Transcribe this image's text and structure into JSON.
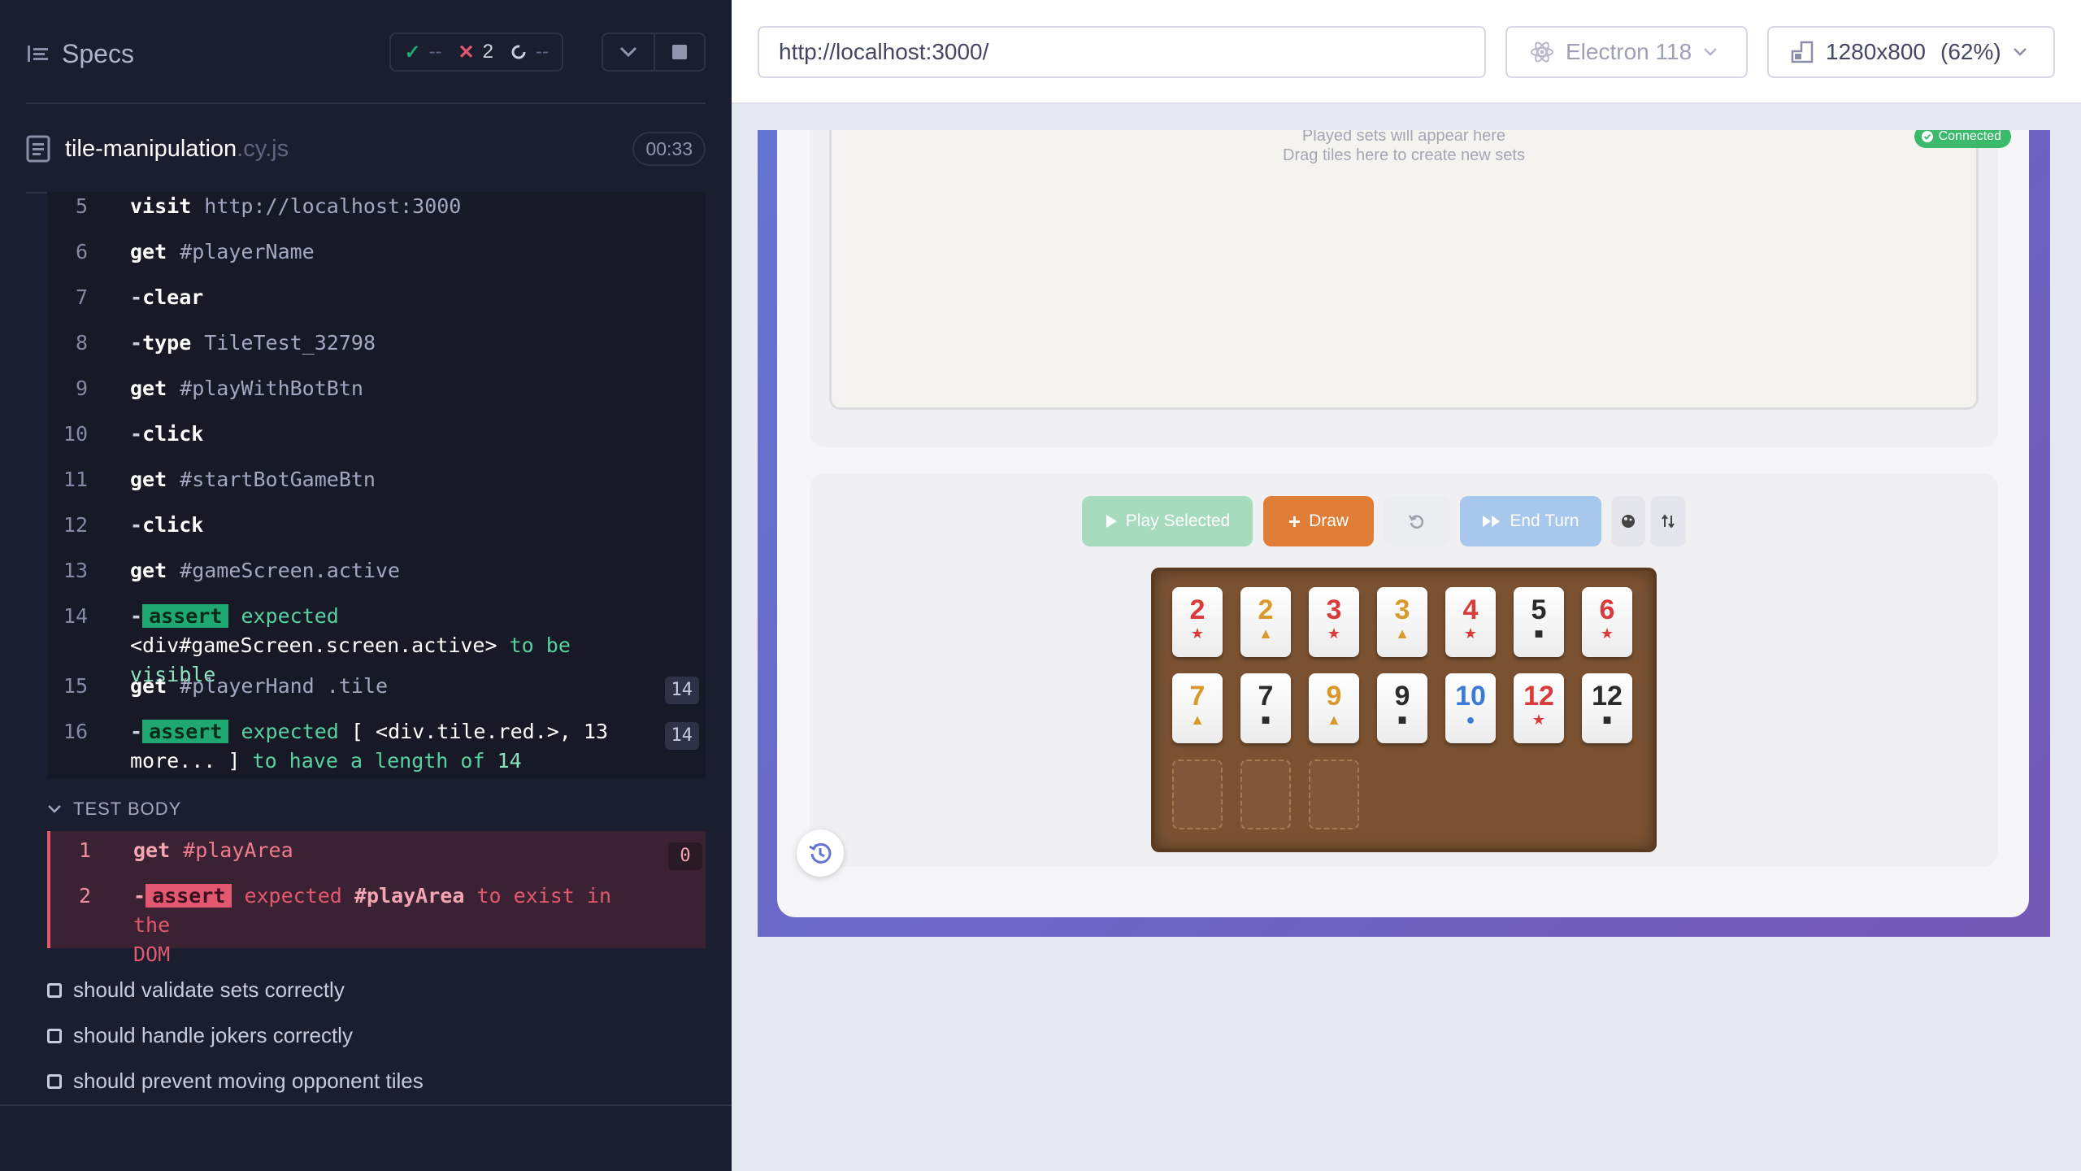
{
  "runner": {
    "header": {
      "title": "Specs",
      "stats": {
        "passed": "--",
        "failed": "2",
        "pending": "--"
      }
    },
    "spec": {
      "file": "tile-manipulation",
      "ext": ".cy.js",
      "duration": "00:33"
    },
    "hook_commands": [
      {
        "num": "5",
        "dash": "",
        "name": "visit",
        "arg": "http://localhost:3000"
      },
      {
        "num": "6",
        "dash": "",
        "name": "get",
        "arg": "#playerName"
      },
      {
        "num": "7",
        "dash": "-",
        "name": "clear",
        "arg": ""
      },
      {
        "num": "8",
        "dash": "-",
        "name": "type",
        "arg": "TileTest_32798"
      },
      {
        "num": "9",
        "dash": "",
        "name": "get",
        "arg": "#playWithBotBtn"
      },
      {
        "num": "10",
        "dash": "-",
        "name": "click",
        "arg": ""
      },
      {
        "num": "11",
        "dash": "",
        "name": "get",
        "arg": "#startBotGameBtn"
      },
      {
        "num": "12",
        "dash": "-",
        "name": "click",
        "arg": ""
      },
      {
        "num": "13",
        "dash": "",
        "name": "get",
        "arg": "#gameScreen.active"
      }
    ],
    "assert14": {
      "num": "14",
      "badge": "assert",
      "w1": "expected",
      "el": "<div#gameScreen.screen.active>",
      "w2": "to be",
      "w3": "visible"
    },
    "cmd15": {
      "num": "15",
      "name": "get",
      "arg": "#playerHand .tile",
      "count": "14"
    },
    "assert16": {
      "num": "16",
      "badge": "assert",
      "w1": "expected",
      "el": "[ <div.tile.red.>, 13",
      "el2": "more... ]",
      "w2": "to have a length of",
      "w3": "14",
      "count": "14"
    },
    "test_body_label": "TEST BODY",
    "fail_cmd1": {
      "num": "1",
      "name": "get",
      "arg": "#playArea",
      "count": "0"
    },
    "fail_cmd2": {
      "num": "2",
      "badge": "assert",
      "w1": "expected",
      "el": "#playArea",
      "w2": "to exist in the",
      "w3": "DOM"
    },
    "tests": [
      "should validate sets correctly",
      "should handle jokers correctly",
      "should prevent moving opponent tiles"
    ]
  },
  "browser": {
    "url": "http://localhost:3000/",
    "engine": "Electron 118",
    "viewport": "1280x800",
    "scale": "(62%)"
  },
  "app": {
    "play_area": {
      "line1": "Played sets will appear here",
      "line2": "Drag tiles here to create new sets"
    },
    "status": "Connected",
    "buttons": {
      "play": "Play Selected",
      "draw": "Draw",
      "end": "End Turn"
    },
    "colors": {
      "red": "#d93b3b",
      "orange": "#d99a2b",
      "black": "#2b2b2b",
      "blue": "#3a7bd5"
    },
    "tiles_row1": [
      {
        "n": "2",
        "c": "red",
        "s": "★"
      },
      {
        "n": "2",
        "c": "orange",
        "s": "▲"
      },
      {
        "n": "3",
        "c": "red",
        "s": "★"
      },
      {
        "n": "3",
        "c": "orange",
        "s": "▲"
      },
      {
        "n": "4",
        "c": "red",
        "s": "★"
      },
      {
        "n": "5",
        "c": "black",
        "s": "■"
      },
      {
        "n": "6",
        "c": "red",
        "s": "★"
      }
    ],
    "tiles_row2": [
      {
        "n": "7",
        "c": "orange",
        "s": "▲"
      },
      {
        "n": "7",
        "c": "black",
        "s": "■"
      },
      {
        "n": "9",
        "c": "orange",
        "s": "▲"
      },
      {
        "n": "9",
        "c": "black",
        "s": "■"
      },
      {
        "n": "10",
        "c": "blue",
        "s": "●"
      },
      {
        "n": "12",
        "c": "red",
        "s": "★"
      },
      {
        "n": "12",
        "c": "black",
        "s": "■"
      }
    ]
  }
}
